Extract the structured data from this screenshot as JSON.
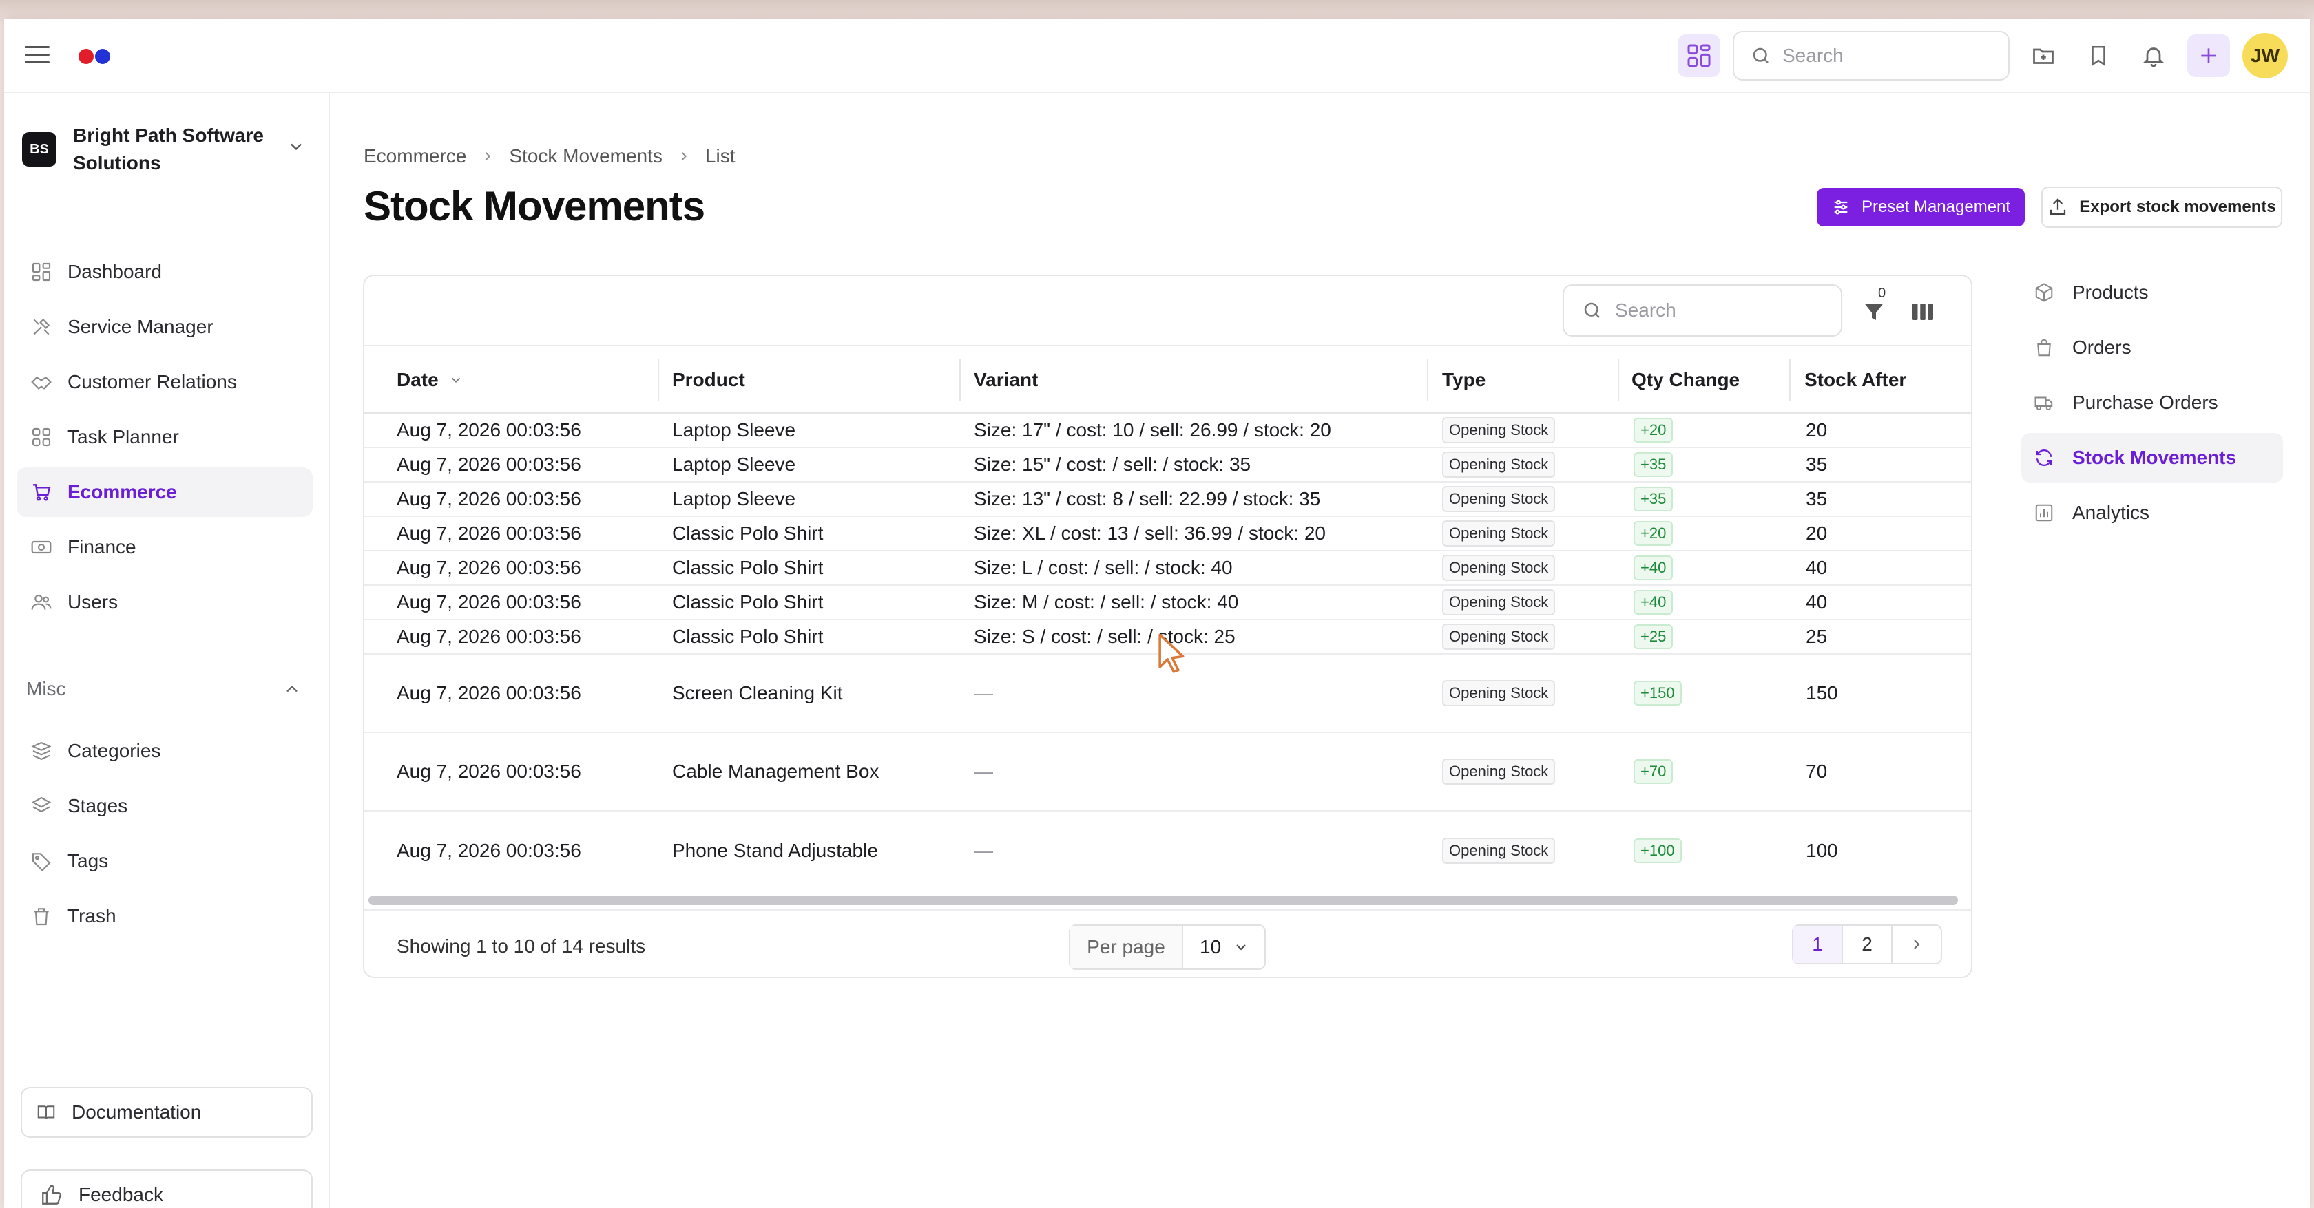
{
  "header": {
    "search_placeholder": "Search",
    "avatar_initials": "JW",
    "logo_colors": [
      "#e11d2a",
      "#2332d6"
    ],
    "accent": "#7b1fe0"
  },
  "org": {
    "initials": "BS",
    "name": "Bright Path Software Solutions"
  },
  "sidebar": {
    "items": [
      {
        "label": "Dashboard",
        "icon": "dashboard-icon"
      },
      {
        "label": "Service Manager",
        "icon": "tools-icon"
      },
      {
        "label": "Customer Relations",
        "icon": "handshake-icon"
      },
      {
        "label": "Task Planner",
        "icon": "grid-icon"
      },
      {
        "label": "Ecommerce",
        "icon": "cart-icon",
        "active": true
      },
      {
        "label": "Finance",
        "icon": "cash-icon"
      },
      {
        "label": "Users",
        "icon": "users-icon"
      }
    ],
    "misc_label": "Misc",
    "misc_items": [
      {
        "label": "Categories",
        "icon": "categories-icon"
      },
      {
        "label": "Stages",
        "icon": "layers-icon"
      },
      {
        "label": "Tags",
        "icon": "tag-icon"
      },
      {
        "label": "Trash",
        "icon": "trash-icon"
      }
    ],
    "documentation": "Documentation",
    "feedback": "Feedback"
  },
  "breadcrumb": [
    "Ecommerce",
    "Stock Movements",
    "List"
  ],
  "page": {
    "title": "Stock Movements",
    "preset_button": "Preset Management",
    "export_button": "Export stock movements"
  },
  "table": {
    "search_placeholder": "Search",
    "filter_count": "0",
    "columns": [
      "Date",
      "Product",
      "Variant",
      "Type",
      "Qty Change",
      "Stock After"
    ],
    "rows": [
      {
        "date": "Aug 7, 2026 00:03:56",
        "product": "Laptop Sleeve",
        "variant": "Size: 17\" / cost: 10 / sell: 26.99 / stock: 20",
        "type": "Opening Stock",
        "qty": "+20",
        "after": "20"
      },
      {
        "date": "Aug 7, 2026 00:03:56",
        "product": "Laptop Sleeve",
        "variant": "Size: 15\" / cost: / sell: / stock: 35",
        "type": "Opening Stock",
        "qty": "+35",
        "after": "35"
      },
      {
        "date": "Aug 7, 2026 00:03:56",
        "product": "Laptop Sleeve",
        "variant": "Size: 13\" / cost: 8 / sell: 22.99 / stock: 35",
        "type": "Opening Stock",
        "qty": "+35",
        "after": "35"
      },
      {
        "date": "Aug 7, 2026 00:03:56",
        "product": "Classic Polo Shirt",
        "variant": "Size: XL / cost: 13 / sell: 36.99 / stock: 20",
        "type": "Opening Stock",
        "qty": "+20",
        "after": "20"
      },
      {
        "date": "Aug 7, 2026 00:03:56",
        "product": "Classic Polo Shirt",
        "variant": "Size: L / cost: / sell: / stock: 40",
        "type": "Opening Stock",
        "qty": "+40",
        "after": "40"
      },
      {
        "date": "Aug 7, 2026 00:03:56",
        "product": "Classic Polo Shirt",
        "variant": "Size: M / cost: / sell: / stock: 40",
        "type": "Opening Stock",
        "qty": "+40",
        "after": "40"
      },
      {
        "date": "Aug 7, 2026 00:03:56",
        "product": "Classic Polo Shirt",
        "variant": "Size: S / cost: / sell: / stock: 25",
        "type": "Opening Stock",
        "qty": "+25",
        "after": "25"
      },
      {
        "date": "Aug 7, 2026 00:03:56",
        "product": "Screen Cleaning Kit",
        "variant": "—",
        "type": "Opening Stock",
        "qty": "+150",
        "after": "150"
      },
      {
        "date": "Aug 7, 2026 00:03:56",
        "product": "Cable Management Box",
        "variant": "—",
        "type": "Opening Stock",
        "qty": "+70",
        "after": "70"
      },
      {
        "date": "Aug 7, 2026 00:03:56",
        "product": "Phone Stand Adjustable",
        "variant": "—",
        "type": "Opening Stock",
        "qty": "+100",
        "after": "100"
      }
    ],
    "showing": "Showing 1 to 10 of 14 results",
    "per_page_label": "Per page",
    "per_page_value": "10",
    "pages": [
      "1",
      "2"
    ],
    "current_page": "1"
  },
  "subnav": [
    {
      "label": "Products",
      "icon": "box-icon"
    },
    {
      "label": "Orders",
      "icon": "bag-icon"
    },
    {
      "label": "Purchase Orders",
      "icon": "truck-icon"
    },
    {
      "label": "Stock Movements",
      "icon": "refresh-icon",
      "active": true
    },
    {
      "label": "Analytics",
      "icon": "chart-icon"
    }
  ]
}
